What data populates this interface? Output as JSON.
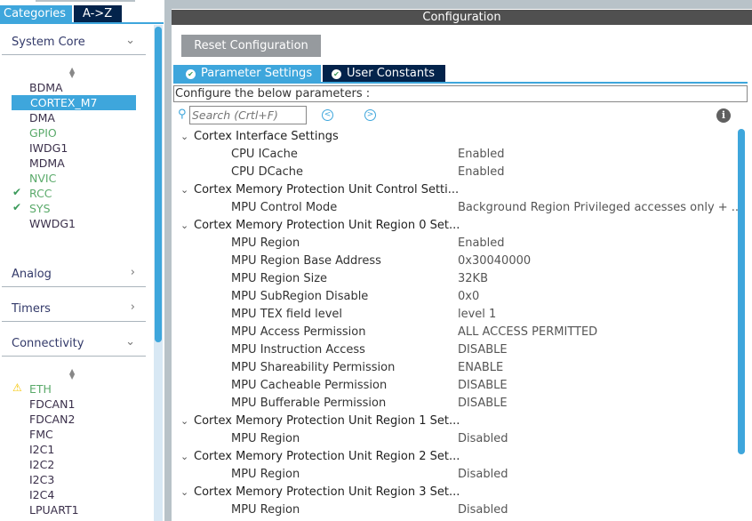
{
  "left_panel": {
    "tabs": [
      "Categories",
      "A->Z"
    ],
    "groups": [
      {
        "label": "System Core",
        "expanded": true,
        "items": [
          {
            "label": "BDMA",
            "state": "normal"
          },
          {
            "label": "CORTEX_M7",
            "state": "selected"
          },
          {
            "label": "DMA",
            "state": "normal"
          },
          {
            "label": "GPIO",
            "state": "green"
          },
          {
            "label": "IWDG1",
            "state": "normal"
          },
          {
            "label": "MDMA",
            "state": "normal"
          },
          {
            "label": "NVIC",
            "state": "green"
          },
          {
            "label": "RCC",
            "state": "checked"
          },
          {
            "label": "SYS",
            "state": "checked"
          },
          {
            "label": "WWDG1",
            "state": "normal"
          }
        ]
      },
      {
        "label": "Analog",
        "expanded": false
      },
      {
        "label": "Timers",
        "expanded": false
      },
      {
        "label": "Connectivity",
        "expanded": true,
        "items": [
          {
            "label": "ETH",
            "state": "warning"
          },
          {
            "label": "FDCAN1",
            "state": "normal"
          },
          {
            "label": "FDCAN2",
            "state": "normal"
          },
          {
            "label": "FMC",
            "state": "normal"
          },
          {
            "label": "I2C1",
            "state": "normal"
          },
          {
            "label": "I2C2",
            "state": "normal"
          },
          {
            "label": "I2C3",
            "state": "normal"
          },
          {
            "label": "I2C4",
            "state": "normal"
          },
          {
            "label": "LPUART1",
            "state": "normal"
          }
        ]
      }
    ]
  },
  "config": {
    "title": "Configuration",
    "reset_label": "Reset Configuration",
    "tabs": [
      "Parameter Settings",
      "User Constants"
    ],
    "prompt": "Configure the below parameters :",
    "search_placeholder": "Search (Crtl+F)",
    "rows": [
      {
        "type": "group",
        "label": "Cortex Interface Settings"
      },
      {
        "type": "param",
        "label": "CPU ICache",
        "value": "Enabled"
      },
      {
        "type": "param",
        "label": "CPU DCache",
        "value": "Enabled"
      },
      {
        "type": "group",
        "label": "Cortex Memory Protection Unit Control Setti..."
      },
      {
        "type": "param",
        "label": "MPU Control Mode",
        "value": "Background Region Privileged accesses only + ..."
      },
      {
        "type": "group",
        "label": "Cortex Memory Protection Unit Region 0 Set..."
      },
      {
        "type": "param",
        "label": "MPU Region",
        "value": "Enabled"
      },
      {
        "type": "param",
        "label": "MPU Region Base Address",
        "value": "0x30040000"
      },
      {
        "type": "param",
        "label": "MPU Region Size",
        "value": "32KB"
      },
      {
        "type": "param",
        "label": "MPU SubRegion Disable",
        "value": "0x0"
      },
      {
        "type": "param",
        "label": "MPU TEX field level",
        "value": "level 1"
      },
      {
        "type": "param",
        "label": "MPU Access Permission",
        "value": "ALL ACCESS PERMITTED"
      },
      {
        "type": "param",
        "label": "MPU Instruction Access",
        "value": "DISABLE"
      },
      {
        "type": "param",
        "label": "MPU Shareability Permission",
        "value": "ENABLE"
      },
      {
        "type": "param",
        "label": "MPU Cacheable Permission",
        "value": "DISABLE"
      },
      {
        "type": "param",
        "label": "MPU Bufferable  Permission",
        "value": "DISABLE"
      },
      {
        "type": "group",
        "label": "Cortex Memory Protection Unit Region 1 Set..."
      },
      {
        "type": "param",
        "label": "MPU Region",
        "value": "Disabled"
      },
      {
        "type": "group",
        "label": "Cortex Memory Protection Unit Region 2 Set..."
      },
      {
        "type": "param",
        "label": "MPU Region",
        "value": "Disabled"
      },
      {
        "type": "group",
        "label": "Cortex Memory Protection Unit Region 3 Set..."
      },
      {
        "type": "param",
        "label": "MPU Region",
        "value": "Disabled"
      }
    ]
  }
}
